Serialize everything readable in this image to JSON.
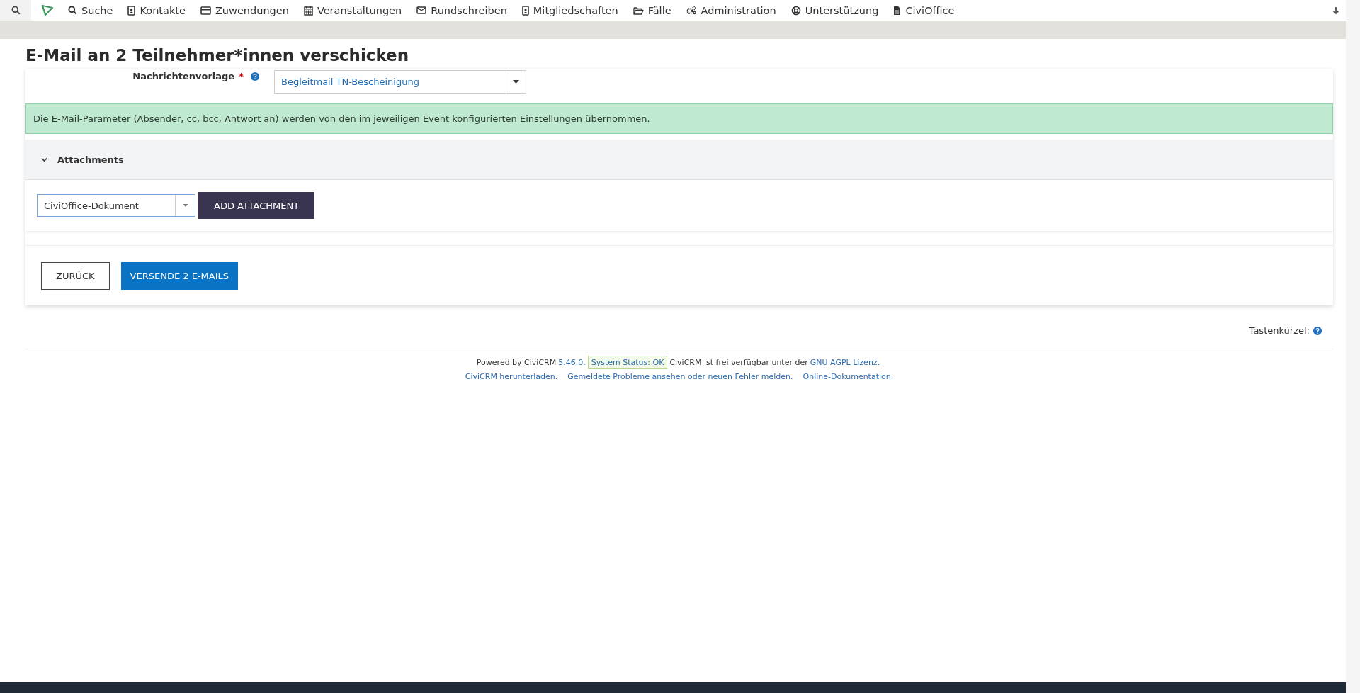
{
  "nav": {
    "items": [
      {
        "label": "Suche"
      },
      {
        "label": "Kontakte"
      },
      {
        "label": "Zuwendungen"
      },
      {
        "label": "Veranstaltungen"
      },
      {
        "label": "Rundschreiben"
      },
      {
        "label": "Mitgliedschaften"
      },
      {
        "label": "Fälle"
      },
      {
        "label": "Administration"
      },
      {
        "label": "Unterstützung"
      },
      {
        "label": "CiviOffice"
      }
    ]
  },
  "page_title": "E-Mail an 2 Teilnehmer*innen verschicken",
  "form": {
    "template_label": "Nachrichtenvorlage",
    "required_mark": "*",
    "template_value": "Begleitmail TN-Bescheinigung",
    "alert": "Die E-Mail-Parameter (Absender, cc, bcc, Antwort an) werden von den im jeweiligen Event konfigurierten Einstellungen übernommen.",
    "attachments": {
      "title": "Attachments",
      "expanded": true,
      "type_value": "CiviOffice-Dokument",
      "add_button": "ADD ATTACHMENT"
    },
    "buttons": [
      {
        "label": "ZURÜCK",
        "kind": "secondary"
      },
      {
        "label": "VERSENDE 2 E-MAILS",
        "kind": "primary"
      }
    ]
  },
  "shortcuts_label": "Tastenkürzel:",
  "footer": {
    "powered": "Powered by CiviCRM",
    "version": "5.46.0.",
    "status": "System Status: OK",
    "license_text": "CiviCRM ist frei verfügbar unter der",
    "license_link": "GNU AGPL Lizenz.",
    "links": [
      "CiviCRM herunterladen.",
      "Gemeldete Probleme ansehen oder neuen Fehler melden.",
      "Online-Dokumentation."
    ]
  }
}
